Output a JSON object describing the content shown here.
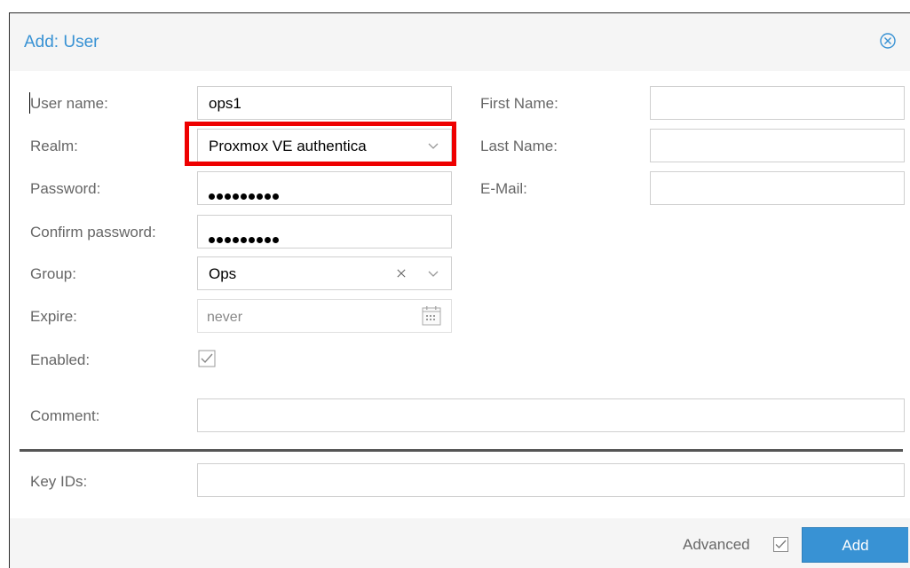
{
  "dialog": {
    "title": "Add: User",
    "close_icon": "close-circle-icon"
  },
  "form": {
    "username": {
      "label": "User name:",
      "value": "ops1"
    },
    "realm": {
      "label": "Realm:",
      "value": "Proxmox VE authentica"
    },
    "password": {
      "label": "Password:",
      "value": "•••••••••"
    },
    "confirm_password": {
      "label": "Confirm password:",
      "value": "•••••••••"
    },
    "group": {
      "label": "Group:",
      "value": "Ops"
    },
    "expire": {
      "label": "Expire:",
      "placeholder": "never"
    },
    "enabled": {
      "label": "Enabled:",
      "checked": true
    },
    "first_name": {
      "label": "First Name:",
      "value": ""
    },
    "last_name": {
      "label": "Last Name:",
      "value": ""
    },
    "email": {
      "label": "E-Mail:",
      "value": ""
    },
    "comment": {
      "label": "Comment:",
      "value": ""
    },
    "key_ids": {
      "label": "Key IDs:",
      "value": ""
    }
  },
  "footer": {
    "advanced_label": "Advanced",
    "advanced_checked": true,
    "add_label": "Add"
  },
  "colors": {
    "accent": "#3892d4",
    "highlight": "#ee0000"
  }
}
